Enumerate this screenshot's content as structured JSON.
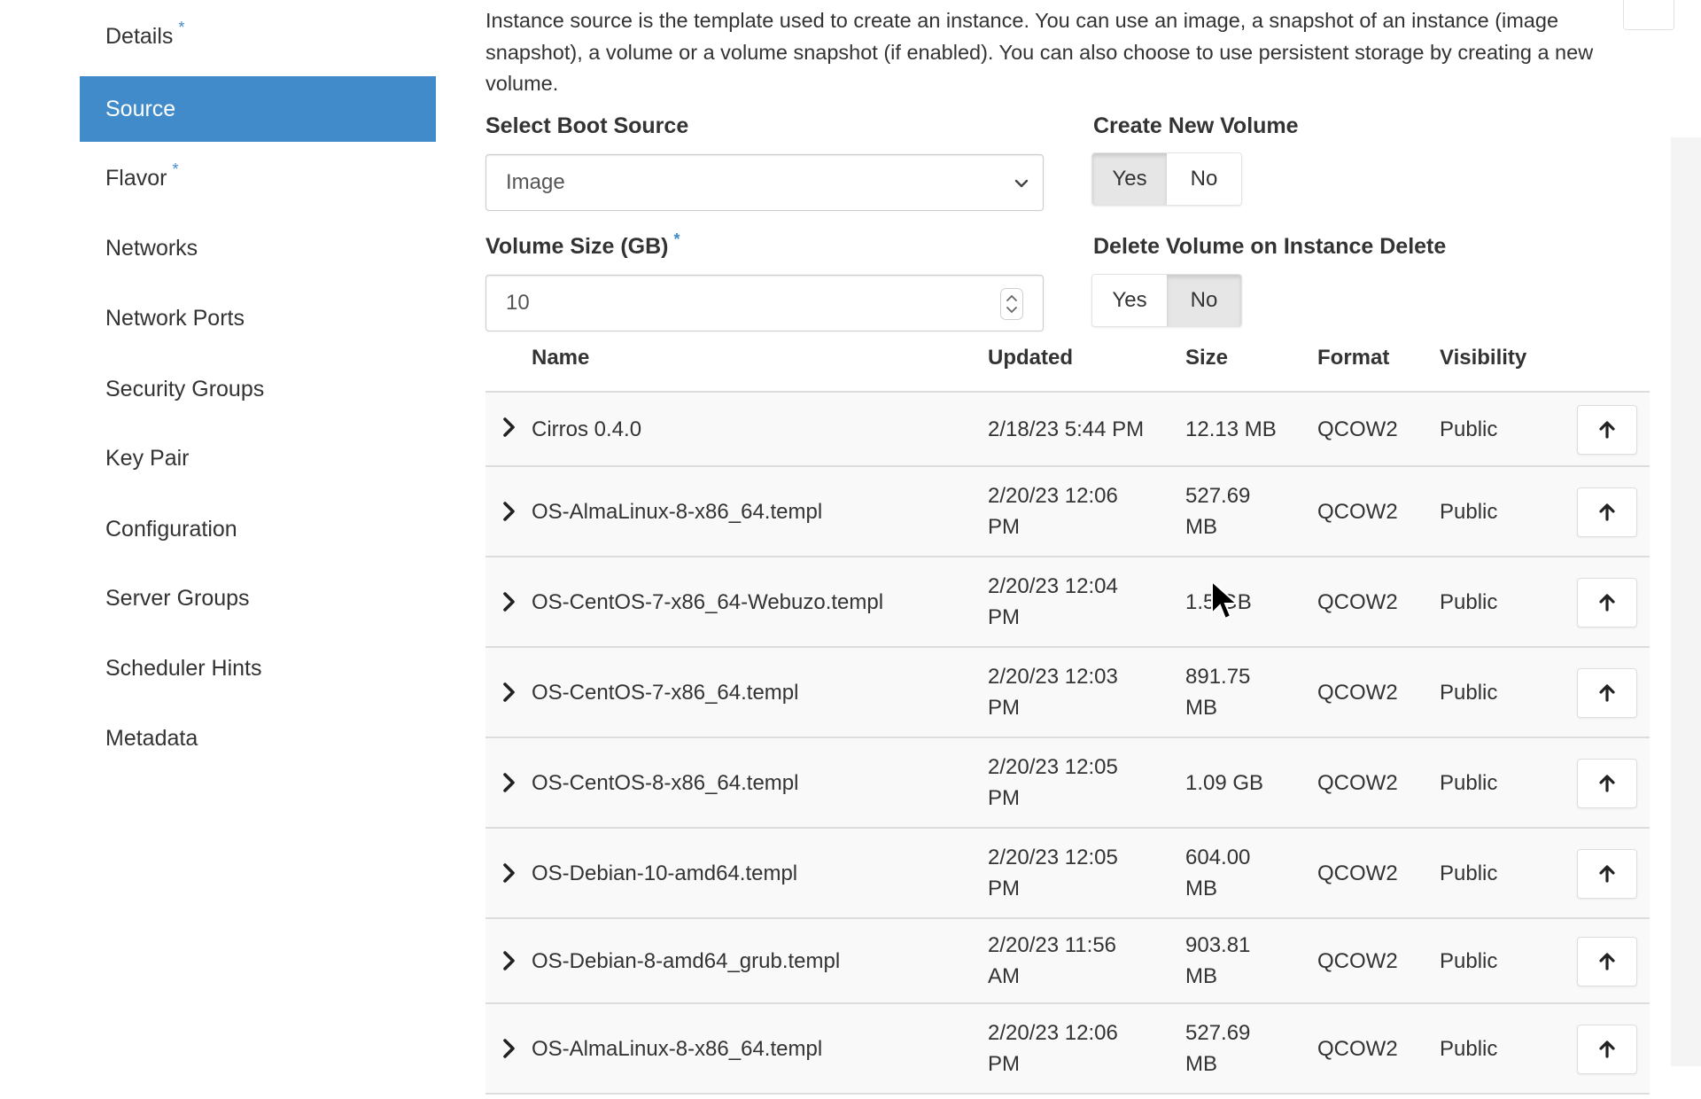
{
  "sidebar": {
    "items": [
      {
        "label": "Details",
        "required": "*"
      },
      {
        "label": "Source"
      },
      {
        "label": "Flavor",
        "required": "*"
      },
      {
        "label": "Networks"
      },
      {
        "label": "Network Ports"
      },
      {
        "label": "Security Groups"
      },
      {
        "label": "Key Pair"
      },
      {
        "label": "Configuration"
      },
      {
        "label": "Server Groups"
      },
      {
        "label": "Scheduler Hints"
      },
      {
        "label": "Metadata"
      }
    ],
    "active": "Source"
  },
  "main": {
    "description": "Instance source is the template used to create an instance. You can use an image, a snapshot of an instance (image snapshot), a volume or a volume snapshot (if enabled). You can also choose to use persistent storage by creating a new volume.",
    "boot_source": {
      "label": "Select Boot Source",
      "value": "Image"
    },
    "create_volume": {
      "label": "Create New Volume",
      "yes": "Yes",
      "no": "No",
      "selected": "Yes"
    },
    "volume_size": {
      "label": "Volume Size (GB)",
      "required": "*",
      "value": "10"
    },
    "delete_volume": {
      "label": "Delete Volume on Instance Delete",
      "yes": "Yes",
      "no": "No",
      "selected": "No"
    },
    "table": {
      "headers": {
        "name": "Name",
        "updated": "Updated",
        "size": "Size",
        "format": "Format",
        "visibility": "Visibility"
      },
      "rows": [
        {
          "name": "Cirros 0.4.0",
          "updated1": "2/18/23 5:44 PM",
          "updated2": "",
          "size1": "12.13 MB",
          "size2": "",
          "format": "QCOW2",
          "visibility": "Public"
        },
        {
          "name": "OS-AlmaLinux-8-x86_64.templ",
          "updated1": "2/20/23 12:06",
          "updated2": "PM",
          "size1": "527.69",
          "size2": "MB",
          "format": "QCOW2",
          "visibility": "Public"
        },
        {
          "name": "OS-CentOS-7-x86_64-Webuzo.templ",
          "updated1": "2/20/23 12:04",
          "updated2": "PM",
          "size1": "1.5 GB",
          "size2": "",
          "format": "QCOW2",
          "visibility": "Public"
        },
        {
          "name": "OS-CentOS-7-x86_64.templ",
          "updated1": "2/20/23 12:03",
          "updated2": "PM",
          "size1": "891.75",
          "size2": "MB",
          "format": "QCOW2",
          "visibility": "Public"
        },
        {
          "name": "OS-CentOS-8-x86_64.templ",
          "updated1": "2/20/23 12:05",
          "updated2": "PM",
          "size1": "1.09 GB",
          "size2": "",
          "format": "QCOW2",
          "visibility": "Public"
        },
        {
          "name": "OS-Debian-10-amd64.templ",
          "updated1": "2/20/23 12:05",
          "updated2": "PM",
          "size1": "604.00",
          "size2": "MB",
          "format": "QCOW2",
          "visibility": "Public"
        },
        {
          "name": "OS-Debian-8-amd64_grub.templ",
          "updated1": "2/20/23 11:56",
          "updated2": "AM",
          "size1": "903.81",
          "size2": "MB",
          "format": "QCOW2",
          "visibility": "Public"
        },
        {
          "name": "OS-AlmaLinux-8-x86_64.templ",
          "updated1": "2/20/23 12:06",
          "updated2": "PM",
          "size1": "527.69",
          "size2": "MB",
          "format": "QCOW2",
          "visibility": "Public"
        }
      ]
    }
  },
  "colors": {
    "accent": "#428bca",
    "row_bg": "#f9f9f9",
    "border": "#dddddd"
  }
}
